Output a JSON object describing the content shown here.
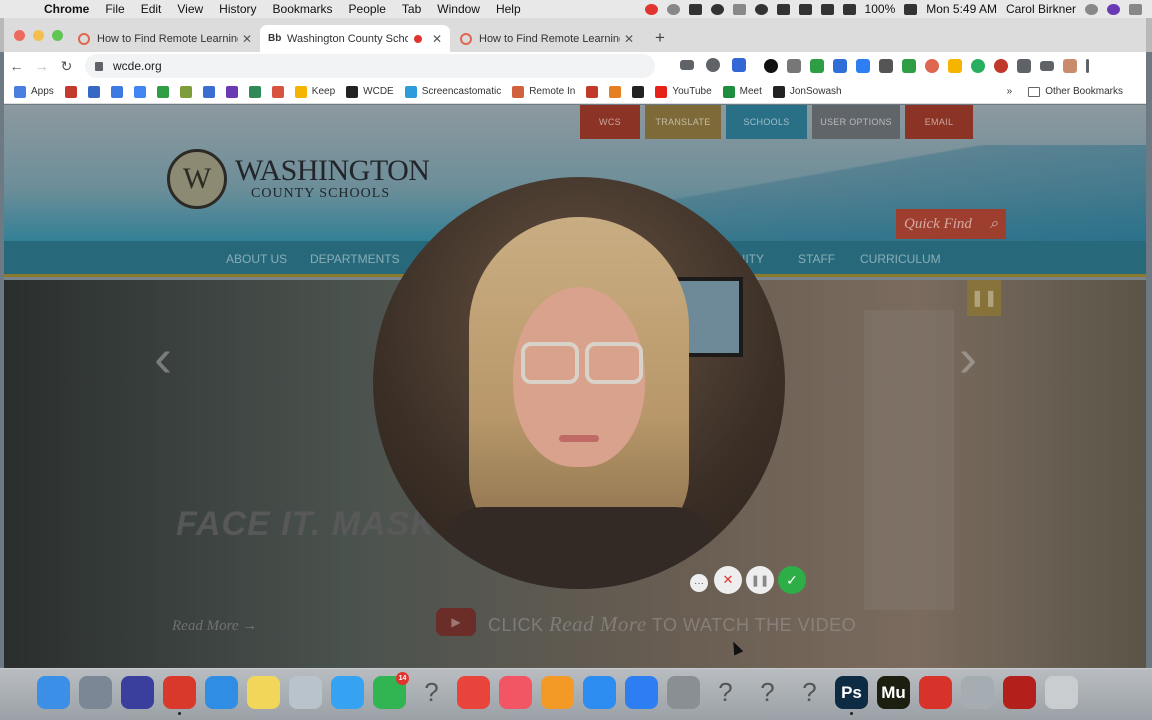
{
  "menubar": {
    "app": "Chrome",
    "items": [
      "File",
      "Edit",
      "View",
      "History",
      "Bookmarks",
      "People",
      "Tab",
      "Window",
      "Help"
    ],
    "battery": "100%",
    "clock": "Mon 5:49 AM",
    "user": "Carol Birkner"
  },
  "tabs": [
    {
      "title": "How to Find Remote Learning S",
      "favicon": "ring-icon"
    },
    {
      "title": "Washington County School",
      "favicon": "Bb"
    },
    {
      "title": "How to Find Remote Learning S",
      "favicon": "ring-icon"
    }
  ],
  "toolbar": {
    "url": "wcde.org"
  },
  "bookmarks": [
    {
      "label": "Apps",
      "color": "#4a7fe0"
    },
    {
      "label": "",
      "color": "#c23b2d"
    },
    {
      "label": "",
      "color": "#3569c4"
    },
    {
      "label": "",
      "color": "#3d7be0"
    },
    {
      "label": "",
      "color": "#4285f4"
    },
    {
      "label": "",
      "color": "#2f9e44"
    },
    {
      "label": "",
      "color": "#7d9d3a"
    },
    {
      "label": "",
      "color": "#3a6fd1"
    },
    {
      "label": "",
      "color": "#6a3ab5"
    },
    {
      "label": "",
      "color": "#2e8b57"
    },
    {
      "label": "",
      "color": "#d8533f"
    },
    {
      "label": "Keep",
      "color": "#f4b400"
    },
    {
      "label": "WCDE",
      "color": "#222222"
    },
    {
      "label": "Screencastomatic",
      "color": "#2d9cdb"
    },
    {
      "label": "Remote In",
      "color": "#d0603e"
    },
    {
      "label": "",
      "color": "#c0392b"
    },
    {
      "label": "",
      "color": "#e67e22"
    },
    {
      "label": "",
      "color": "#222222"
    },
    {
      "label": "YouTube",
      "color": "#e62117"
    },
    {
      "label": "Meet",
      "color": "#1e8e3e"
    },
    {
      "label": "JonSowash",
      "color": "#222222"
    }
  ],
  "other_bookmarks": "Other Bookmarks",
  "site": {
    "top_buttons": [
      {
        "label": "WCS",
        "color": "#8b3325",
        "width": 60
      },
      {
        "label": "TRANSLATE",
        "color": "#7e6a38",
        "width": 76
      },
      {
        "label": "SCHOOLS",
        "color": "#296f86",
        "width": 81
      },
      {
        "label": "USER OPTIONS",
        "color": "#606569",
        "width": 88
      },
      {
        "label": "EMAIL",
        "color": "#8b3325",
        "width": 68
      }
    ],
    "logo_l1": "WASHINGTON",
    "logo_l2": "COUNTY SCHOOLS",
    "logo_mark": "W",
    "quick_find": "Quick Find",
    "nav": [
      "ABOUT US",
      "DEPARTMENTS",
      "UNITY",
      "STAFF",
      "CURRICULUM"
    ],
    "slogan": "FACE IT. MASK",
    "read_more": "Read More",
    "watch": {
      "a": "CLICK",
      "b": "Read More",
      "c": "TO WATCH THE VIDEO"
    }
  },
  "dock": [
    {
      "name": "finder-icon",
      "color": "#3b8fe6",
      "glyph": ""
    },
    {
      "name": "launchpad-icon",
      "color": "#7b8794",
      "glyph": ""
    },
    {
      "name": "siri-icon",
      "color": "#3a3f9e",
      "glyph": ""
    },
    {
      "name": "chrome-icon",
      "color": "#d9392b",
      "glyph": "",
      "running": true
    },
    {
      "name": "safari-icon",
      "color": "#2f8de4",
      "glyph": ""
    },
    {
      "name": "notes-icon",
      "color": "#f2d65a",
      "glyph": ""
    },
    {
      "name": "preview-icon",
      "color": "#b9c3cb",
      "glyph": ""
    },
    {
      "name": "messages-icon",
      "color": "#35a3f2",
      "glyph": ""
    },
    {
      "name": "facetime-icon",
      "color": "#31b553",
      "glyph": "",
      "badge": "14"
    },
    {
      "name": "unknown-app-icon",
      "color": "",
      "glyph": "?"
    },
    {
      "name": "news-icon",
      "color": "#e9443c",
      "glyph": ""
    },
    {
      "name": "music-icon",
      "color": "#f25563",
      "glyph": ""
    },
    {
      "name": "books-icon",
      "color": "#f39a26",
      "glyph": ""
    },
    {
      "name": "app-store-icon",
      "color": "#2d8cf0",
      "glyph": ""
    },
    {
      "name": "zoom-icon",
      "color": "#2d7ef2",
      "glyph": ""
    },
    {
      "name": "system-preferences-icon",
      "color": "#8a8f94",
      "glyph": ""
    },
    {
      "name": "unknown-app-icon",
      "color": "",
      "glyph": "?"
    },
    {
      "name": "unknown-app-icon",
      "color": "",
      "glyph": "?"
    },
    {
      "name": "unknown-app-icon",
      "color": "",
      "glyph": "?"
    },
    {
      "name": "photoshop-icon",
      "color": "#0e2b44",
      "glyph": "Ps",
      "running": true
    },
    {
      "name": "muse-icon",
      "color": "#1c1f10",
      "glyph": "Mu"
    },
    {
      "name": "creative-cloud-icon",
      "color": "#d7332b",
      "glyph": ""
    },
    {
      "name": "image-capture-icon",
      "color": "#a5adb3",
      "glyph": ""
    },
    {
      "name": "acrobat-icon",
      "color": "#b31f1a",
      "glyph": ""
    },
    {
      "name": "trash-icon",
      "color": "#c9cdd0",
      "glyph": ""
    }
  ]
}
